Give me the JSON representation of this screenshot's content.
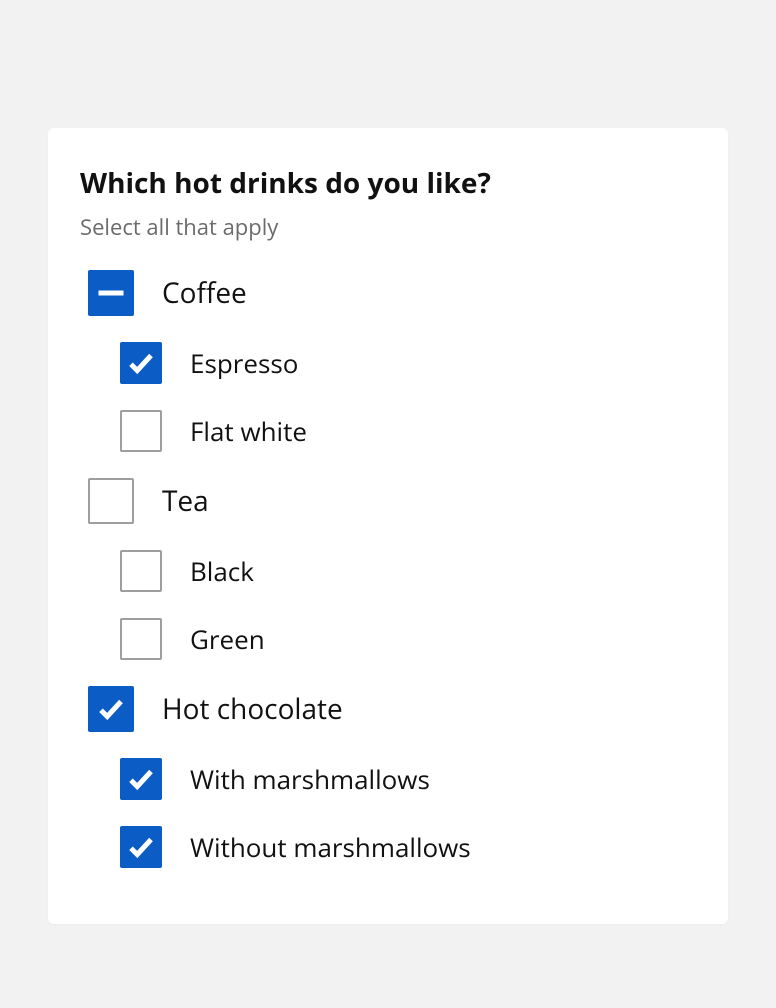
{
  "heading": "Which hot drinks do you like?",
  "hint": "Select all that apply",
  "groups": [
    {
      "label": "Coffee",
      "state": "indeterminate",
      "children": [
        {
          "label": "Espresso",
          "state": "checked"
        },
        {
          "label": "Flat white",
          "state": "unchecked"
        }
      ]
    },
    {
      "label": "Tea",
      "state": "unchecked",
      "children": [
        {
          "label": "Black",
          "state": "unchecked"
        },
        {
          "label": "Green",
          "state": "unchecked"
        }
      ]
    },
    {
      "label": "Hot chocolate",
      "state": "checked",
      "children": [
        {
          "label": "With marshmallows",
          "state": "checked"
        },
        {
          "label": "Without marshmallows",
          "state": "checked"
        }
      ]
    }
  ]
}
